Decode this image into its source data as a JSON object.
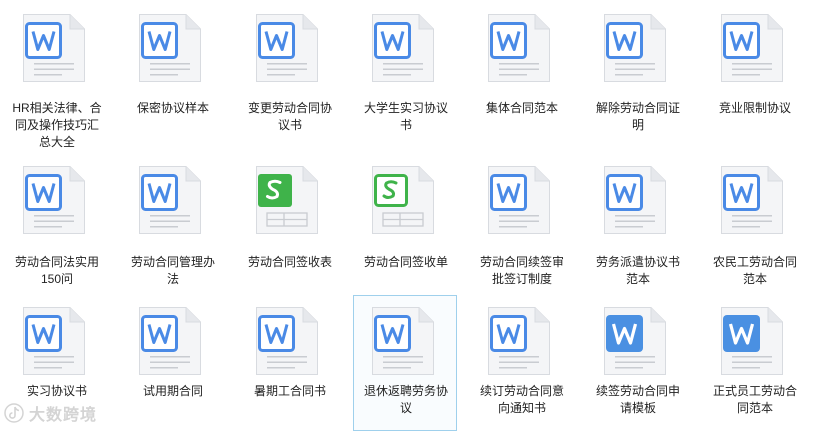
{
  "colors": {
    "word_blue": "#4a8ae6",
    "word_solid": "#4a90e2",
    "sheet_green": "#3fb34a",
    "page_fill": "#f4f5f7",
    "page_line": "#c9ccd1"
  },
  "watermark": {
    "text": "大数跨境",
    "icon": "tiktok-logo-icon"
  },
  "files": [
    {
      "name": "HR相关法律、合同及操作技巧汇总大全",
      "icon": "word",
      "lines": [
        "HR相关法律、合",
        "同及操作技巧汇",
        "总大全"
      ]
    },
    {
      "name": "保密协议样本",
      "icon": "word",
      "lines": [
        "保密协议样本"
      ]
    },
    {
      "name": "变更劳动合同协议书",
      "icon": "word",
      "lines": [
        "变更劳动合同协",
        "议书"
      ]
    },
    {
      "name": "大学生实习协议书",
      "icon": "word",
      "lines": [
        "大学生实习协议",
        "书"
      ]
    },
    {
      "name": "集体合同范本",
      "icon": "word",
      "lines": [
        "集体合同范本"
      ]
    },
    {
      "name": "解除劳动合同证明",
      "icon": "word",
      "lines": [
        "解除劳动合同证",
        "明"
      ]
    },
    {
      "name": "竞业限制协议",
      "icon": "word",
      "lines": [
        "竞业限制协议"
      ]
    },
    {
      "name": "劳动合同法实用150问",
      "icon": "word",
      "lines": [
        "劳动合同法实用",
        "150问"
      ]
    },
    {
      "name": "劳动合同管理办法",
      "icon": "word",
      "lines": [
        "劳动合同管理办",
        "法"
      ]
    },
    {
      "name": "劳动合同签收表",
      "icon": "sheet-solid",
      "lines": [
        "劳动合同签收表"
      ]
    },
    {
      "name": "劳动合同签收单",
      "icon": "sheet-outline",
      "lines": [
        "劳动合同签收单"
      ]
    },
    {
      "name": "劳动合同续签审批签订制度",
      "icon": "word",
      "lines": [
        "劳动合同续签审",
        "批签订制度"
      ]
    },
    {
      "name": "劳务派遣协议书范本",
      "icon": "word",
      "lines": [
        "劳务派遣协议书",
        "范本"
      ]
    },
    {
      "name": "农民工劳动合同范本",
      "icon": "word",
      "lines": [
        "农民工劳动合同",
        "范本"
      ]
    },
    {
      "name": "实习协议书",
      "icon": "word",
      "lines": [
        "实习协议书"
      ]
    },
    {
      "name": "试用期合同",
      "icon": "word",
      "lines": [
        "试用期合同"
      ]
    },
    {
      "name": "暑期工合同书",
      "icon": "word",
      "lines": [
        "暑期工合同书"
      ]
    },
    {
      "name": "退休返聘劳务协议",
      "icon": "word",
      "selected": true,
      "lines": [
        "退休返聘劳务协",
        "议"
      ]
    },
    {
      "name": "续订劳动合同意向通知书",
      "icon": "word",
      "lines": [
        "续订劳动合同意",
        "向通知书"
      ]
    },
    {
      "name": "续签劳动合同申请模板",
      "icon": "word-solid",
      "lines": [
        "续签劳动合同申",
        "请模板"
      ]
    },
    {
      "name": "正式员工劳动合同范本",
      "icon": "word-solid",
      "lines": [
        "正式员工劳动合",
        "同范本"
      ]
    }
  ]
}
